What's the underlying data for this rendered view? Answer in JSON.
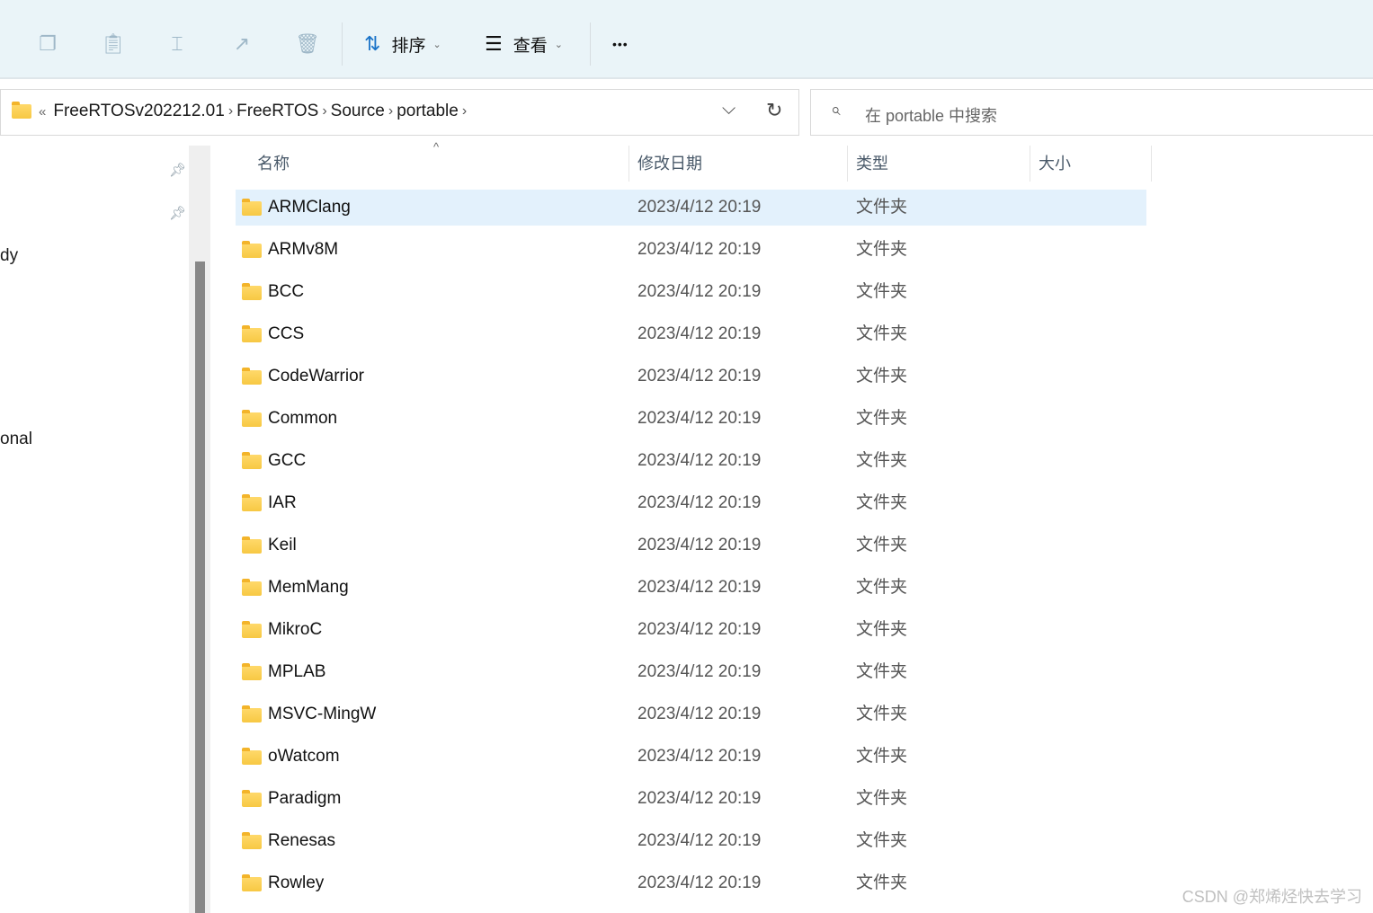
{
  "toolbar": {
    "sort_label": "排序",
    "view_label": "查看",
    "more_label": "•••"
  },
  "address": {
    "overflow": "«",
    "crumbs": [
      "FreeRTOSv202212.01",
      "FreeRTOS",
      "Source",
      "portable"
    ]
  },
  "search": {
    "placeholder": "在 portable 中搜索"
  },
  "sidebar": {
    "partial_items": [
      "dy",
      "onal"
    ]
  },
  "columns": {
    "name": "名称",
    "date": "修改日期",
    "type": "类型",
    "size": "大小"
  },
  "files": [
    {
      "name": "ARMClang",
      "date": "2023/4/12 20:19",
      "type": "文件夹"
    },
    {
      "name": "ARMv8M",
      "date": "2023/4/12 20:19",
      "type": "文件夹"
    },
    {
      "name": "BCC",
      "date": "2023/4/12 20:19",
      "type": "文件夹"
    },
    {
      "name": "CCS",
      "date": "2023/4/12 20:19",
      "type": "文件夹"
    },
    {
      "name": "CodeWarrior",
      "date": "2023/4/12 20:19",
      "type": "文件夹"
    },
    {
      "name": "Common",
      "date": "2023/4/12 20:19",
      "type": "文件夹"
    },
    {
      "name": "GCC",
      "date": "2023/4/12 20:19",
      "type": "文件夹"
    },
    {
      "name": "IAR",
      "date": "2023/4/12 20:19",
      "type": "文件夹"
    },
    {
      "name": "Keil",
      "date": "2023/4/12 20:19",
      "type": "文件夹"
    },
    {
      "name": "MemMang",
      "date": "2023/4/12 20:19",
      "type": "文件夹"
    },
    {
      "name": "MikroC",
      "date": "2023/4/12 20:19",
      "type": "文件夹"
    },
    {
      "name": "MPLAB",
      "date": "2023/4/12 20:19",
      "type": "文件夹"
    },
    {
      "name": "MSVC-MingW",
      "date": "2023/4/12 20:19",
      "type": "文件夹"
    },
    {
      "name": "oWatcom",
      "date": "2023/4/12 20:19",
      "type": "文件夹"
    },
    {
      "name": "Paradigm",
      "date": "2023/4/12 20:19",
      "type": "文件夹"
    },
    {
      "name": "Renesas",
      "date": "2023/4/12 20:19",
      "type": "文件夹"
    },
    {
      "name": "Rowley",
      "date": "2023/4/12 20:19",
      "type": "文件夹"
    }
  ],
  "watermark": "CSDN @郑烯烃快去学习"
}
